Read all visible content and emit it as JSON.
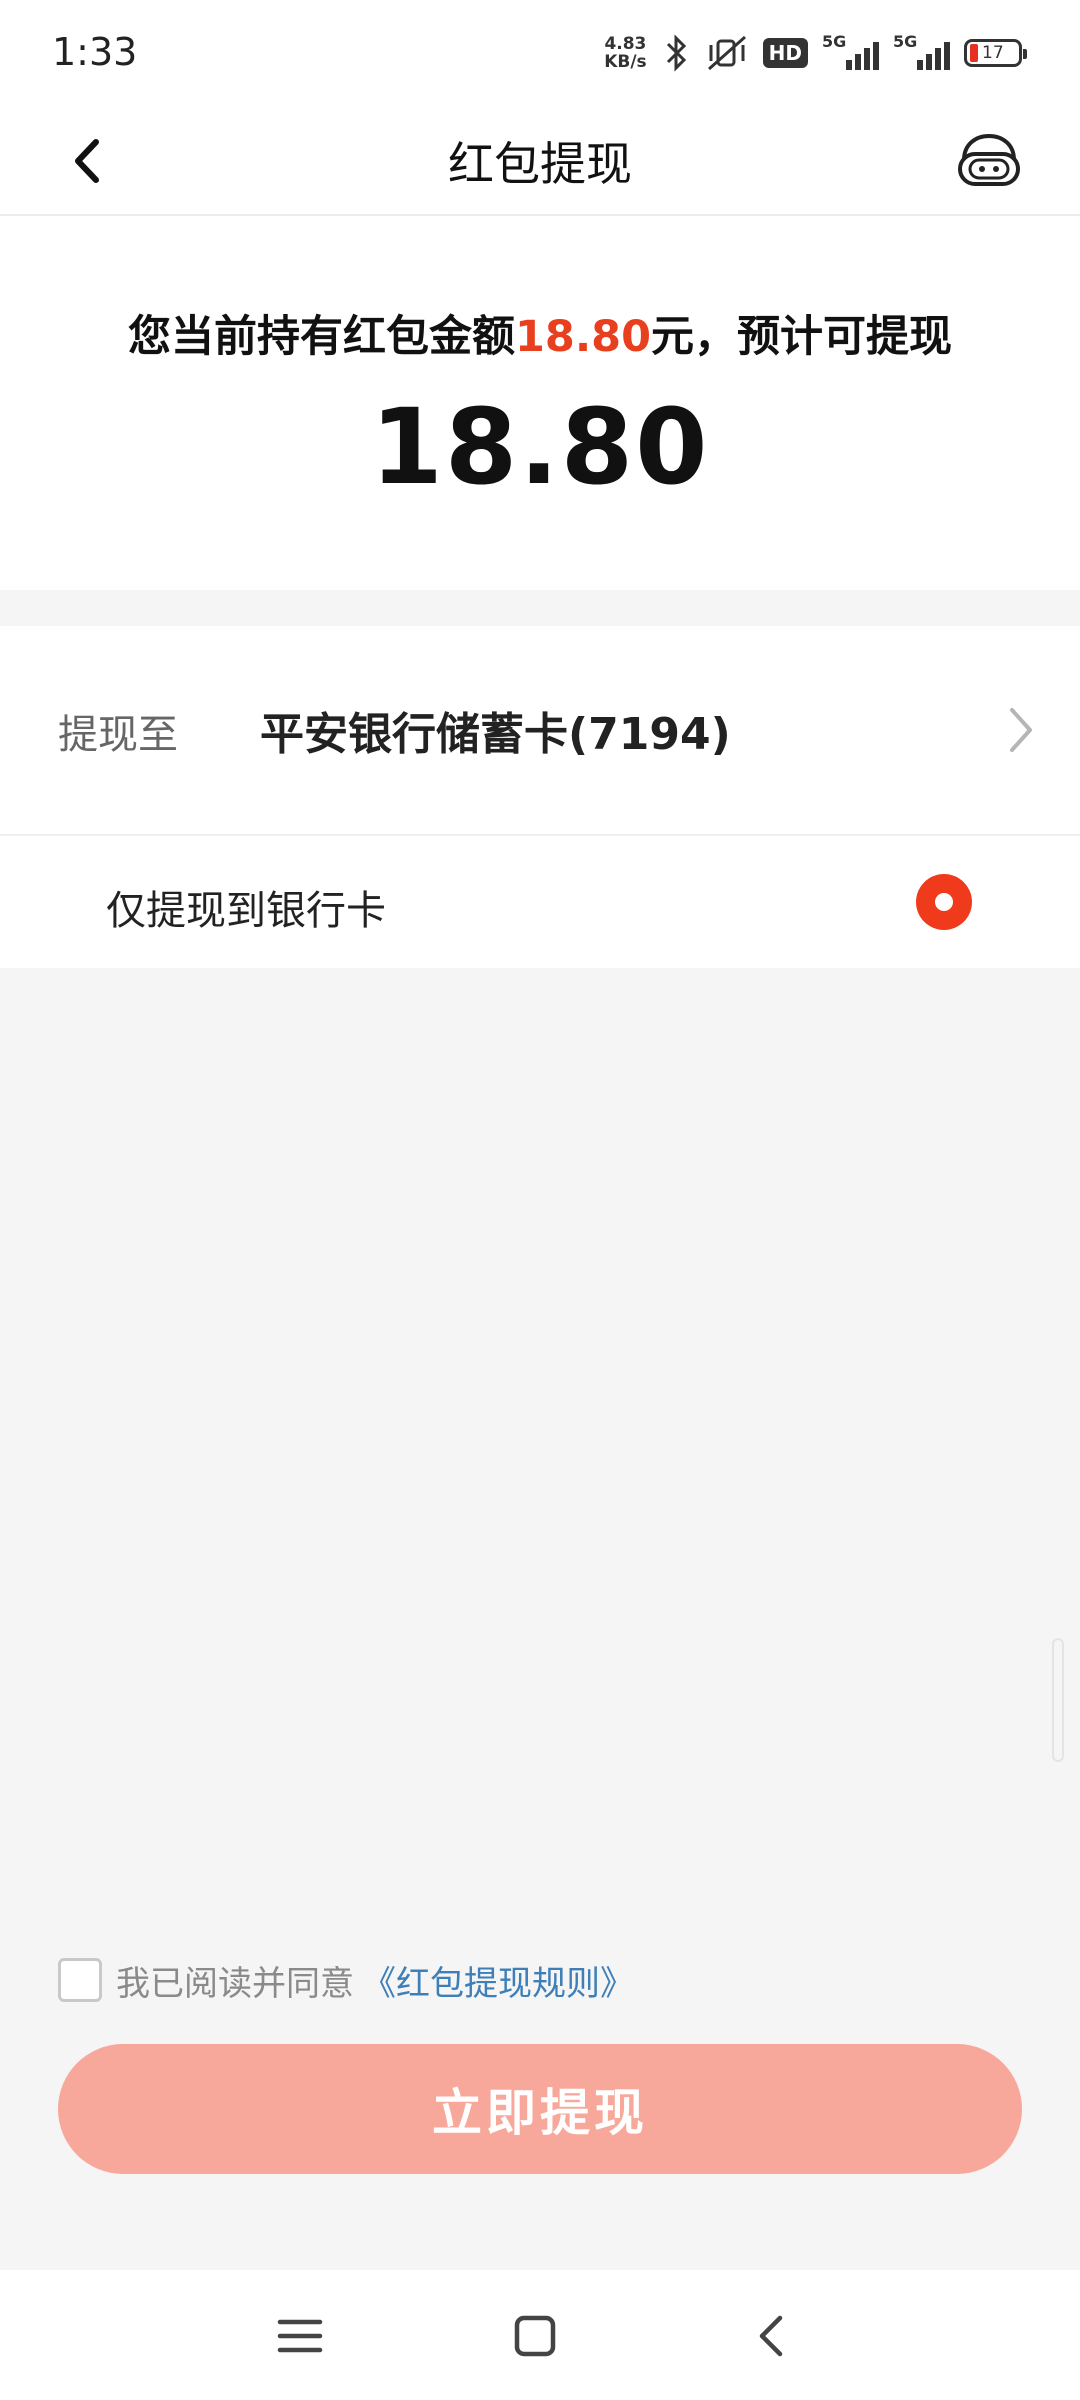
{
  "status_bar": {
    "time": "1:33",
    "net_speed_value": "4.83",
    "net_speed_unit": "KB/s",
    "hd_label": "HD",
    "network_1": "5G",
    "network_2": "5G",
    "battery_level": "17",
    "icons": [
      "bluetooth-icon",
      "mute-icon",
      "signal-icon",
      "battery-icon"
    ]
  },
  "nav": {
    "title": "红包提现",
    "back_icon": "chevron-left-icon",
    "service_icon": "customer-service-icon"
  },
  "summary": {
    "prefix": "您当前持有红包金额",
    "held_amount": "18.80",
    "suffix": "元，预计可提现",
    "withdrawable_amount": "18.80",
    "highlight_color": "#e8401f"
  },
  "destination": {
    "label": "提现至",
    "value": "平安银行储蓄卡(7194)"
  },
  "option": {
    "label": "仅提现到银行卡",
    "selected": true,
    "radio_color": "#ef3b1c"
  },
  "agreement": {
    "text": "我已阅读并同意",
    "link": "《红包提现规则》",
    "checked": false
  },
  "submit": {
    "label": "立即提现",
    "color": "#f7a89a"
  },
  "system_nav": {
    "icons": [
      "menu-icon",
      "home-icon",
      "back-icon"
    ]
  }
}
